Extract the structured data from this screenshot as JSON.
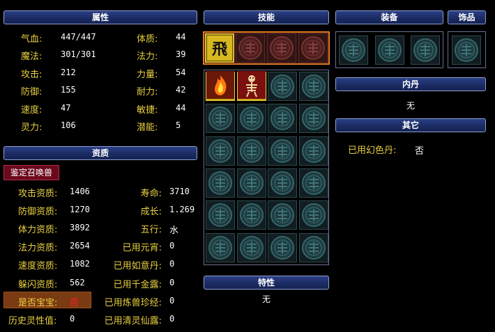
{
  "headers": {
    "attributes": "属性",
    "skills": "技能",
    "equipment": "装备",
    "accessory": "饰品",
    "aptitude": "资质",
    "neidan": "内丹",
    "other": "其它",
    "trait": "特性"
  },
  "attributes": {
    "left": [
      {
        "label": "气血:",
        "value": "447/447"
      },
      {
        "label": "魔法:",
        "value": "301/301"
      },
      {
        "label": "攻击:",
        "value": "212"
      },
      {
        "label": "防御:",
        "value": "155"
      },
      {
        "label": "速度:",
        "value": "47"
      },
      {
        "label": "灵力:",
        "value": "106"
      }
    ],
    "right": [
      {
        "label": "体质:",
        "value": "44"
      },
      {
        "label": "法力:",
        "value": "39"
      },
      {
        "label": "力量:",
        "value": "54"
      },
      {
        "label": "耐力:",
        "value": "42"
      },
      {
        "label": "敏捷:",
        "value": "44"
      },
      {
        "label": "潜能:",
        "value": "5"
      }
    ]
  },
  "identify_button": "鉴定召唤兽",
  "aptitude": {
    "left": [
      {
        "label": "攻击资质:",
        "value": "1406"
      },
      {
        "label": "防御资质:",
        "value": "1270"
      },
      {
        "label": "体力资质:",
        "value": "3892"
      },
      {
        "label": "法力资质:",
        "value": "2654"
      },
      {
        "label": "速度资质:",
        "value": "1082"
      },
      {
        "label": "躲闪资质:",
        "value": "562"
      },
      {
        "label": "是否宝宝:",
        "value": "否"
      },
      {
        "label": "历史灵性值:",
        "value": "0"
      }
    ],
    "right": [
      {
        "label": "寿命:",
        "value": "3710"
      },
      {
        "label": "成长:",
        "value": "1.269"
      },
      {
        "label": "五行:",
        "value": "水"
      },
      {
        "label": "已用元宵:",
        "value": "0"
      },
      {
        "label": "已用如意丹:",
        "value": "0"
      },
      {
        "label": "已用千金露:",
        "value": "0"
      },
      {
        "label": "已用炼兽珍经:",
        "value": "0"
      },
      {
        "label": "已用清灵仙露:",
        "value": "0"
      }
    ]
  },
  "neidan_value": "无",
  "trait_value": "无",
  "other": {
    "label": "已用幻色丹:",
    "value": "否"
  },
  "skills": {
    "special": [
      {
        "icon": "fly-rune-icon",
        "glyph": "飛"
      }
    ],
    "learned": [
      {
        "icon": "flame-skill-icon"
      },
      {
        "icon": "skeleton-skill-icon"
      }
    ]
  },
  "colors": {
    "label": "#e8d040",
    "header_bg": "#1c2c63",
    "skill_border": "#e07a22",
    "baby_no": "#ff2020"
  }
}
